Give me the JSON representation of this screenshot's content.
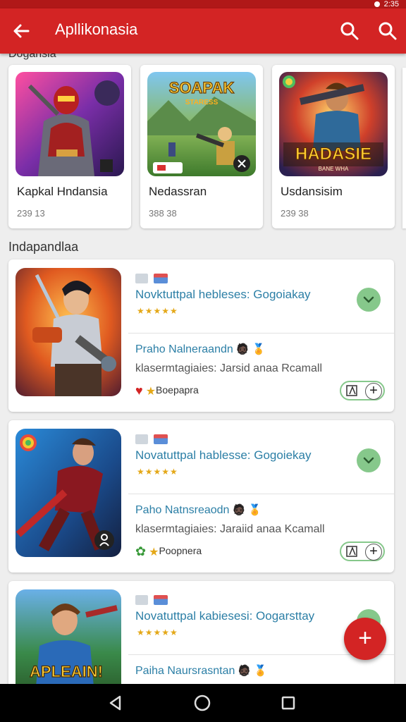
{
  "status": {
    "time": "2:35"
  },
  "appbar": {
    "title": "Apllikonasia",
    "back_icon": "arrow-left-icon",
    "search_icon": "search-icon"
  },
  "sections": {
    "featured_label": "Dogansia",
    "list_label": "Indapandlaa"
  },
  "featured": [
    {
      "name": "Kapkal Hndansia",
      "meta": "239 13"
    },
    {
      "name": "Nedassran",
      "meta": "388 38",
      "logo_line1": "SOAPAK",
      "logo_line2": "STARESS"
    },
    {
      "name": "Usdansisim",
      "meta": "239 38",
      "logo_line1": "HADASIE",
      "logo_line2": "BANE WHA"
    }
  ],
  "list": [
    {
      "title": "Novktuttpal hebleses: Gogoiakay",
      "stars": "★★★★★",
      "subtitle": "Praho Nalneraandn",
      "desc": "klasermtagiaies: Jarsid anaa Rcamall",
      "tag": "Boepapra"
    },
    {
      "title": "Novatuttpal hablesse: Gogoiekay",
      "stars": "★★★★★",
      "subtitle": "Paho Natnsreaodn",
      "desc": "klasermtagiaies: Jaraiid anaa Kcamall",
      "tag": "Poopnera"
    },
    {
      "title": "Novatuttpal kabiesesi: Oogarsttay",
      "stars": "★★★★★",
      "subtitle": "Paiha Naursrasntan",
      "banner": "APLEAIN!"
    }
  ],
  "colors": {
    "primary": "#d32424",
    "link": "#2c7fa6",
    "accent_green": "#86c88b",
    "star": "#e4a818"
  }
}
